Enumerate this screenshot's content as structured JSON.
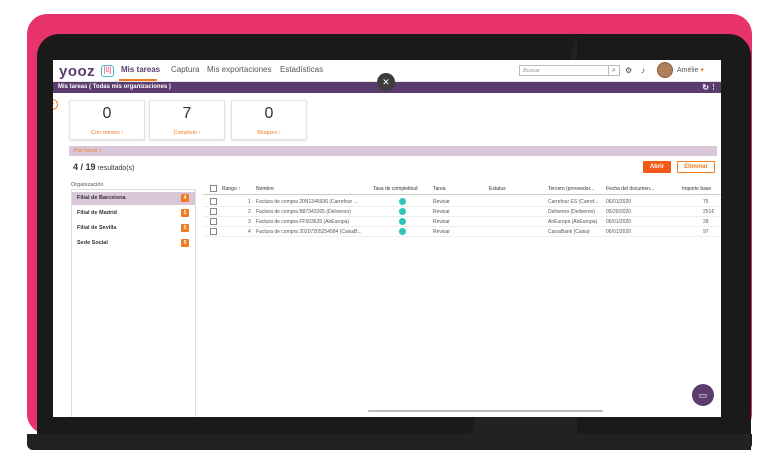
{
  "app": {
    "logo_text": "yooz",
    "logo_box": "[0]",
    "brand_color": "#5a3d6e",
    "accent_color": "#f27b22",
    "card_color": "#e8336a"
  },
  "nav": [
    "Mis tareas",
    "Captura",
    "Mis exportaciones",
    "Estadísticas"
  ],
  "search": {
    "placeholder": "Buscar"
  },
  "icons": {
    "search": "search-icon",
    "settings": "gear-icon",
    "notifications": "bell-icon"
  },
  "user": {
    "name": "Amélie"
  },
  "subheader": {
    "title": "Mis tareas ( Todas mis organizaciones )"
  },
  "kpis": [
    {
      "value": "0",
      "label": "Con retraso"
    },
    {
      "value": "7",
      "label": "Completo"
    },
    {
      "value": "0",
      "label": "Bloqueo"
    }
  ],
  "section": {
    "title": "Por hacer"
  },
  "results": {
    "count": "4 / 19",
    "label": "resultado(s)"
  },
  "actions": {
    "open": "Abrir",
    "delete": "Eliminar"
  },
  "organizations": {
    "label": "Organización",
    "items": [
      {
        "name": "Filial de Barcelona",
        "count": "4"
      },
      {
        "name": "Filial de Madrid",
        "count": "5"
      },
      {
        "name": "Filial de Sevilla",
        "count": "5"
      },
      {
        "name": "Sede Social",
        "count": "5"
      }
    ]
  },
  "table": {
    "columns": [
      "Rango",
      "Nombre",
      "Tasa de completitud",
      "Tarea",
      "Estatus",
      "Tercero (proveedor...",
      "Fecha del documen...",
      "Importe base"
    ],
    "rows": [
      {
        "rank": "1",
        "name": "Factura de compra 20N1346936 (Carrefour ...",
        "task": "Revisar",
        "status": "",
        "third_party": "Carrefour ES (Carref...",
        "date": "06/01/2020",
        "amount": "75"
      },
      {
        "rank": "2",
        "name": "Factura de compra B87343265 (Deliveroo)",
        "task": "Revisar",
        "status": "",
        "third_party": "Deliveroo (Deliveroo)",
        "date": "05/20/2020",
        "amount": "251€"
      },
      {
        "rank": "3",
        "name": "Factura de compra FF503635 (AirEuropa)",
        "task": "Revisar",
        "status": "",
        "third_party": "AirEuropa (AirEuropa)",
        "date": "06/01/2020",
        "amount": "28"
      },
      {
        "rank": "4",
        "name": "Factura de compra 20207205254584 (CaixaB...",
        "task": "Revisar",
        "status": "",
        "third_party": "CaixaBank (Caixa)",
        "date": "06/01/2020",
        "amount": "97"
      }
    ]
  }
}
